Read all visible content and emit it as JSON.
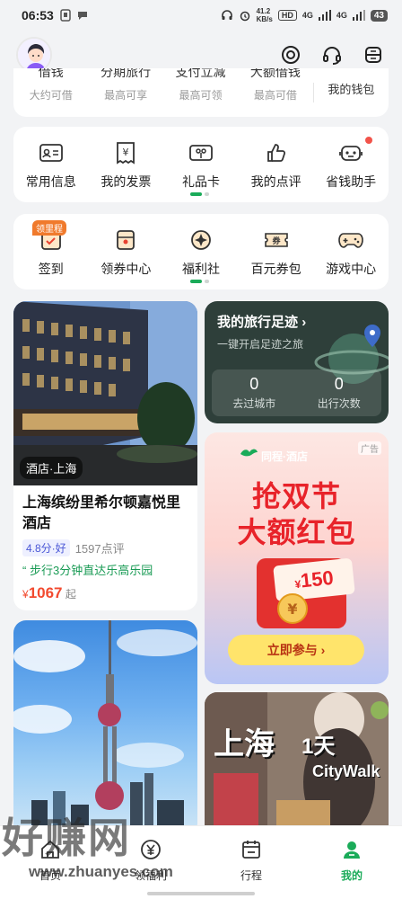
{
  "status_bar": {
    "time": "06:53",
    "net_speed": "41.2",
    "net_unit": "KB/s",
    "hd1": "HD",
    "sig1": "4G",
    "sig2": "4G",
    "battery": "43"
  },
  "wallet_strip": {
    "items": [
      {
        "cut": "借钱",
        "sub": "大约可借"
      },
      {
        "cut": "分期旅行",
        "sub": "最高可享"
      },
      {
        "cut": "支付立减",
        "sub": "最高可领"
      },
      {
        "cut": "大额借钱",
        "sub": "最高可借"
      },
      {
        "cut": "",
        "sub": "我的钱包"
      }
    ]
  },
  "grid1": {
    "items": [
      {
        "label": "常用信息",
        "icon": "id-card-icon"
      },
      {
        "label": "我的发票",
        "icon": "invoice-icon"
      },
      {
        "label": "礼品卡",
        "icon": "gift-card-icon"
      },
      {
        "label": "我的点评",
        "icon": "thumbs-up-icon"
      },
      {
        "label": "省钱助手",
        "icon": "robot-icon"
      }
    ]
  },
  "grid2": {
    "badge": "领里程",
    "items": [
      {
        "label": "签到",
        "icon": "calendar-check-icon"
      },
      {
        "label": "领券中心",
        "icon": "coupon-icon"
      },
      {
        "label": "福利社",
        "icon": "welfare-icon"
      },
      {
        "label": "百元券包",
        "icon": "voucher-icon"
      },
      {
        "label": "游戏中心",
        "icon": "gamepad-icon"
      }
    ]
  },
  "hotel": {
    "tag": "酒店·上海",
    "name": "上海缤纷里希尔顿嘉悦里酒店",
    "rating": "4.8分·好",
    "reviews": "1597点评",
    "note": "步行3分钟直达乐高乐园",
    "currency": "¥",
    "price": "1067",
    "price_suffix": "起"
  },
  "footprint": {
    "title": "我的旅行足迹",
    "arrow": "›",
    "subtitle": "一键开启足迹之旅",
    "stats": [
      {
        "value": "0",
        "label": "去过城市"
      },
      {
        "value": "0",
        "label": "出行次数"
      }
    ]
  },
  "ad": {
    "brand": "同程·酒店",
    "flag": "广告",
    "line1": "抢双节",
    "line2": "大额红包",
    "amount_symbol": "¥",
    "amount": "150",
    "button": "立即参与 ›"
  },
  "citywalk": {
    "city": "上海",
    "days": "1天",
    "walk": "CityWalk"
  },
  "tabbar": {
    "tabs": [
      {
        "label": "首页",
        "icon": "home-icon"
      },
      {
        "label": "领福利",
        "icon": "yen-coin-icon"
      },
      {
        "label": "行程",
        "icon": "itinerary-icon"
      },
      {
        "label": "我的",
        "icon": "user-icon",
        "active": true
      }
    ]
  },
  "watermark": {
    "main": "好赚网",
    "url": "www.zhuanyes.com"
  },
  "colors": {
    "brand_green": "#1aab59",
    "price_red": "#f24a2f",
    "background": "#f2f3f5"
  }
}
